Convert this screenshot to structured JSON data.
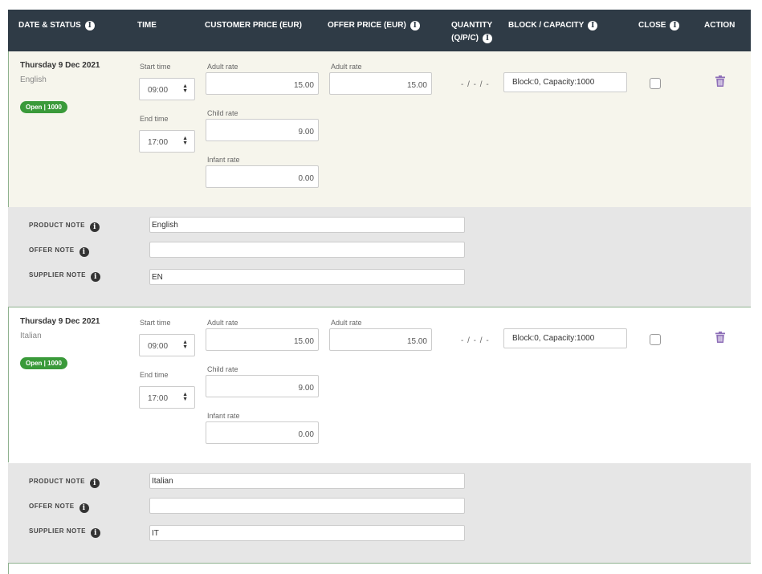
{
  "header": {
    "date_status": "DATE & STATUS",
    "time": "TIME",
    "customer_price": "CUSTOMER PRICE (EUR)",
    "offer_price": "OFFER PRICE (EUR)",
    "quantity_line1": "QUANTITY",
    "quantity_line2": "(Q/P/C)",
    "block_capacity": "BLOCK / CAPACITY",
    "close": "CLOSE",
    "action": "ACTION"
  },
  "labels": {
    "start_time": "Start time",
    "end_time": "End time",
    "adult_rate": "Adult rate",
    "child_rate": "Child rate",
    "infant_rate": "Infant rate",
    "product_note": "PRODUCT NOTE",
    "offer_note": "OFFER NOTE",
    "supplier_note": "SUPPLIER NOTE"
  },
  "rows": [
    {
      "date": "Thursday 9 Dec 2021",
      "language": "English",
      "status": "Open | 1000",
      "start_time": "09:00",
      "end_time": "17:00",
      "customer_adult": "15.00",
      "customer_child": "9.00",
      "customer_infant": "0.00",
      "offer_adult": "15.00",
      "quantity": "- / - / -",
      "block_capacity": "Block:0, Capacity:1000",
      "closed": false,
      "product_note": "English",
      "offer_note": "",
      "supplier_note": "EN"
    },
    {
      "date": "Thursday 9 Dec 2021",
      "language": "Italian",
      "status": "Open | 1000",
      "start_time": "09:00",
      "end_time": "17:00",
      "customer_adult": "15.00",
      "customer_child": "9.00",
      "customer_infant": "0.00",
      "offer_adult": "15.00",
      "quantity": "- / - / -",
      "block_capacity": "Block:0, Capacity:1000",
      "closed": false,
      "product_note": "Italian",
      "offer_note": "",
      "supplier_note": "IT"
    }
  ],
  "colors": {
    "header_bg": "#2f3b46",
    "status_green": "#3a9a3a",
    "row_highlight": "#f6f5ec",
    "notes_bg": "#e6e6e6",
    "trash_icon": "#8e6fb8"
  },
  "icons": {
    "info": "info-circle-icon",
    "trash": "trash-icon",
    "select_arrows": "sort-arrows-icon"
  }
}
